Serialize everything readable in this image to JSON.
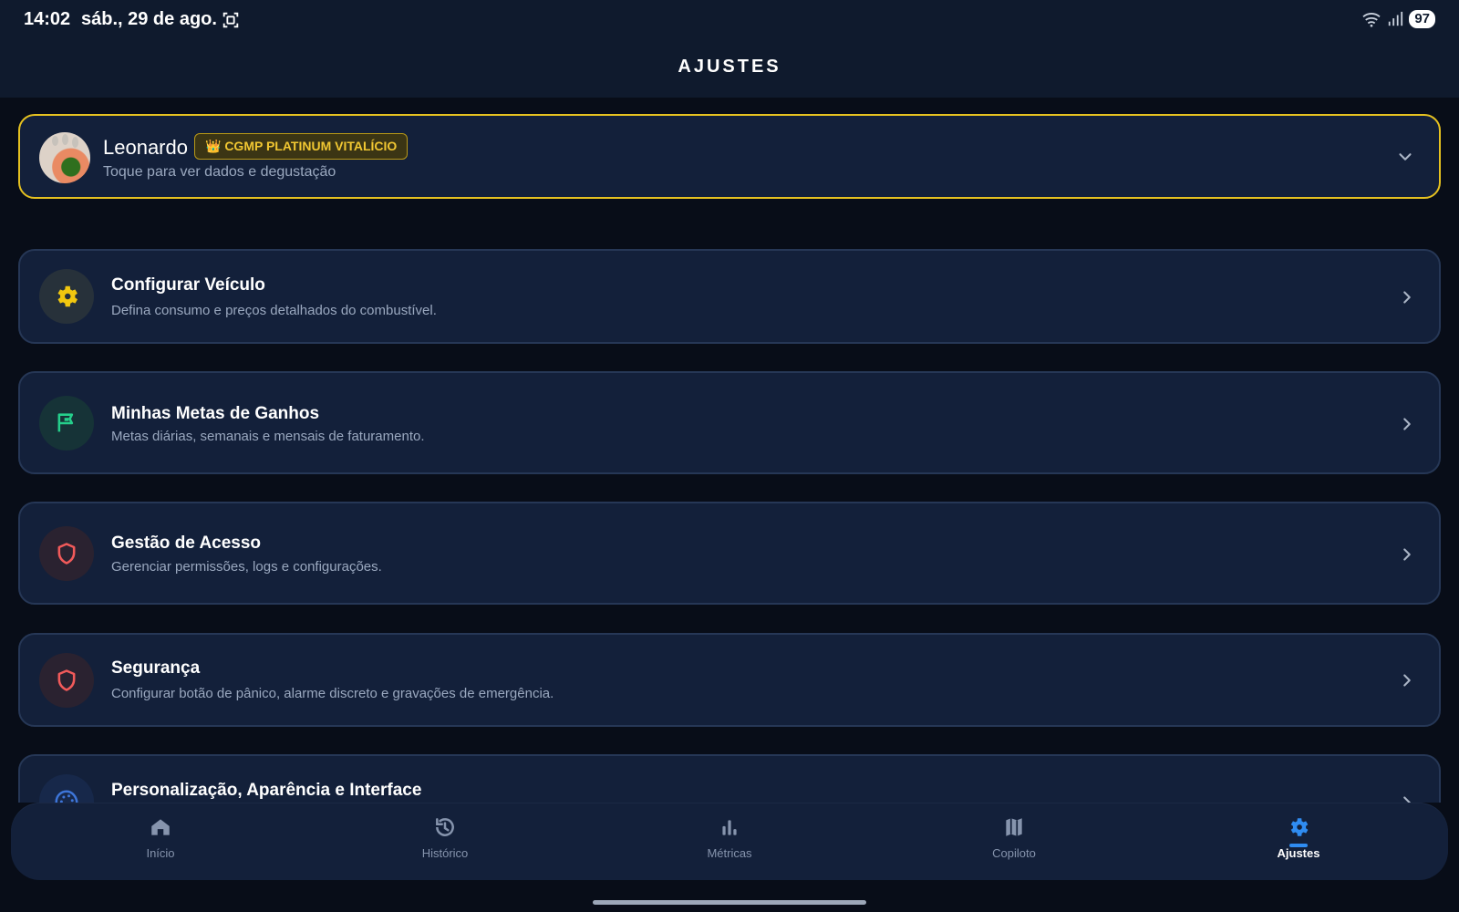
{
  "status_bar": {
    "time": "14:02",
    "date": "sáb., 29 de ago.",
    "battery": "97",
    "icons": [
      "screenshot-icon",
      "wifi-icon",
      "signal-icon",
      "battery-icon"
    ]
  },
  "app_bar": {
    "title": "AJUSTES"
  },
  "profile": {
    "name": "Leonardo",
    "badge": "👑 CGMP PLATINUM VITALÍCIO",
    "subtitle": "Toque para ver dados e degustação",
    "icons": [
      "avatar",
      "chevron-down-icon"
    ],
    "accent": "#e5c120"
  },
  "settings": {
    "items": [
      {
        "title": "Configurar Veículo",
        "subtitle": "Defina consumo e preços detalhados do combustível.",
        "icon": "gear-icon",
        "icon_color": "#f1c70f"
      },
      {
        "title": "Minhas Metas de Ganhos",
        "subtitle": "Metas diárias, semanais e mensais de faturamento.",
        "icon": "flag-icon",
        "icon_color": "#25cf8b"
      },
      {
        "title": "Gestão de Acesso",
        "subtitle": "Gerenciar permissões, logs e configurações.",
        "icon": "shield-icon",
        "icon_color": "#f15a5a"
      },
      {
        "title": "Segurança",
        "subtitle": "Configurar botão de pânico, alarme discreto e gravações de emergência.",
        "icon": "shield-icon",
        "icon_color": "#f15a5a"
      },
      {
        "title": "Personalização, Aparência e Interface",
        "subtitle": "",
        "icon": "palette-icon",
        "icon_color": "#3d75d8"
      }
    ]
  },
  "bottom_nav": {
    "items": [
      {
        "label": "Início",
        "icon": "home-icon",
        "active": false
      },
      {
        "label": "Histórico",
        "icon": "history-icon",
        "active": false
      },
      {
        "label": "Métricas",
        "icon": "bar-chart-icon",
        "active": false
      },
      {
        "label": "Copiloto",
        "icon": "map-icon",
        "active": false
      },
      {
        "label": "Ajustes",
        "icon": "gear-icon",
        "active": true
      }
    ],
    "active_color": "#2f8cf1"
  },
  "colors": {
    "background": "#080d18",
    "header": "#0f1a2d",
    "card": "#13203a",
    "muted_text": "#9aa8bf"
  }
}
